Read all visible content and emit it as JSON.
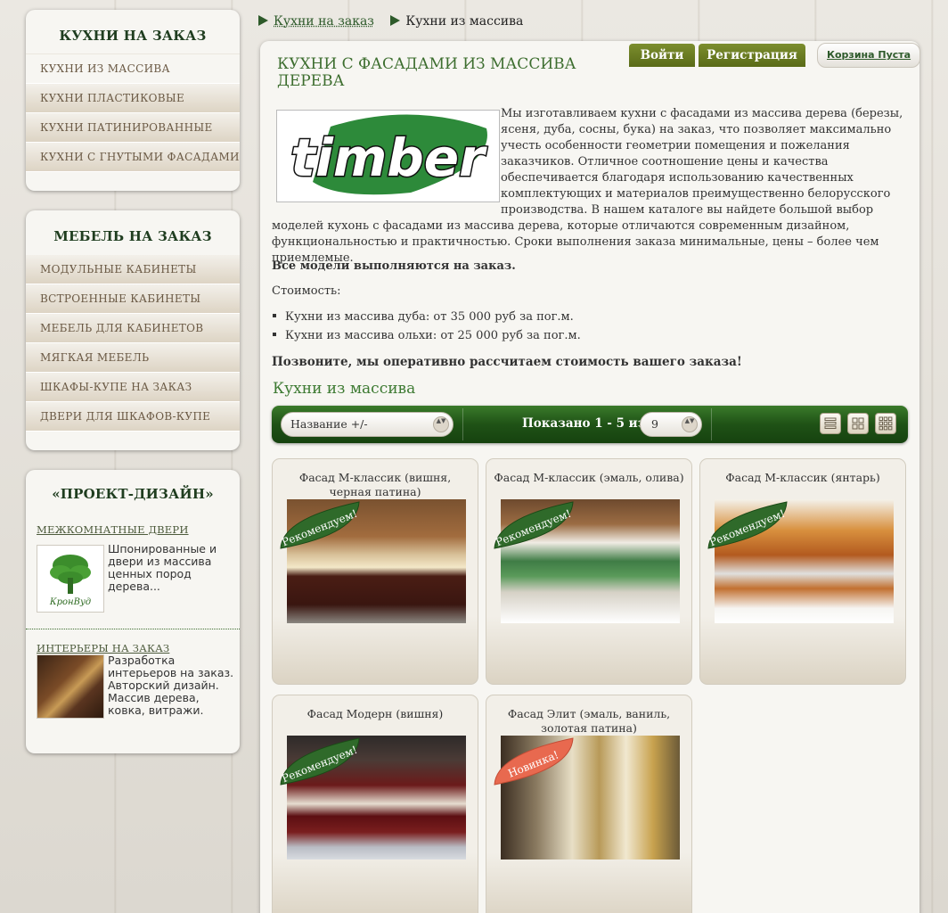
{
  "sidebar": {
    "kitchens": {
      "title": "КУХНИ НА ЗАКАЗ",
      "items": [
        "КУХНИ ИЗ МАССИВА",
        "КУХНИ ПЛАСТИКОВЫЕ",
        "КУХНИ ПАТИНИРОВАННЫЕ",
        "КУХНИ С ГНУТЫМИ ФАСАДАМИ"
      ]
    },
    "furniture": {
      "title": "МЕБЕЛЬ НА ЗАКАЗ",
      "items": [
        "МОДУЛЬНЫЕ КАБИНЕТЫ",
        "ВСТРОЕННЫЕ КАБИНЕТЫ",
        "МЕБЕЛЬ ДЛЯ КАБИНЕТОВ",
        "МЯГКАЯ МЕБЕЛЬ",
        "ШКАФЫ-КУПЕ НА ЗАКАЗ",
        "ДВЕРИ ДЛЯ ШКАФОВ-КУПЕ"
      ]
    },
    "project": {
      "title": "«ПРОЕКТ-ДИЗАЙН»",
      "doors": {
        "title": "МЕЖКОМНАТНЫЕ ДВЕРИ",
        "text": "Шпонированные и двери из массива ценных пород дерева...",
        "logo_text": "КронВуд"
      },
      "interiors": {
        "title": "ИНТЕРЬЕРЫ НА ЗАКАЗ",
        "text": "Разработка интерьеров на заказ. Авторский дизайн. Массив дерева, ковка, витражи."
      }
    }
  },
  "breadcrumbs": {
    "parent": "Кухни на заказ",
    "current": "Кухни из массива"
  },
  "header": {
    "login": "Войти",
    "register": "Регистрация",
    "cart": "Корзина Пуста"
  },
  "page": {
    "title": "КУХНИ С ФАСАДАМИ ИЗ МАССИВА ДЕРЕВА",
    "logo_text": "timber",
    "description": "Мы изготавливаем кухни с фасадами из массива дерева (березы, ясеня, дуба, сосны, бука) на заказ, что позволяет максимально учесть особенности геометрии помещения и пожелания заказчиков. Отличное соотношение цены и качества обеспечивается благодаря использованию качественных комплектующих и материалов преимущественно белорусского производства. В нашем каталоге вы найдете большой выбор моделей кухонь с фасадами из массива дерева, которые отличаются современным дизайном, функциональностью и практичностью. Сроки выполнения заказа минимальные, цены – более чем приемлемые.",
    "all_models": "Все модели выполняются на заказ.",
    "cost_label": "Стоимость:",
    "prices": [
      "Кухни из массива дуба: от 35 000 руб за пог.м.",
      "Кухни из массива ольхи: от 25 000 руб за пог.м."
    ],
    "call": "Позвоните, мы оперативно рассчитаем стоимость вашего заказа!",
    "subtitle": "Кухни из массива"
  },
  "toolbar": {
    "sort": "Название +/-",
    "shown": "Показано 1 - 5 из 5",
    "per_page": "9",
    "sort_chevrons": "▲▼",
    "accent": "#1f5216"
  },
  "products": [
    {
      "title": "Фасад М-классик (вишня, черная патина)",
      "badge": "Рекомендуем!",
      "badge_color": "#2f6a2a"
    },
    {
      "title": "Фасад М-классик (эмаль, олива)",
      "badge": "Рекомендуем!",
      "badge_color": "#2f6a2a"
    },
    {
      "title": "Фасад М-классик (янтарь)",
      "badge": "Рекомендуем!",
      "badge_color": "#2f6a2a"
    },
    {
      "title": "Фасад Модерн (вишня)",
      "badge": "Рекомендуем!",
      "badge_color": "#2f6a2a"
    },
    {
      "title": "Фасад Элит (эмаль, ваниль, золотая патина)",
      "badge": "Новинка!",
      "badge_color": "#e8694f"
    }
  ]
}
